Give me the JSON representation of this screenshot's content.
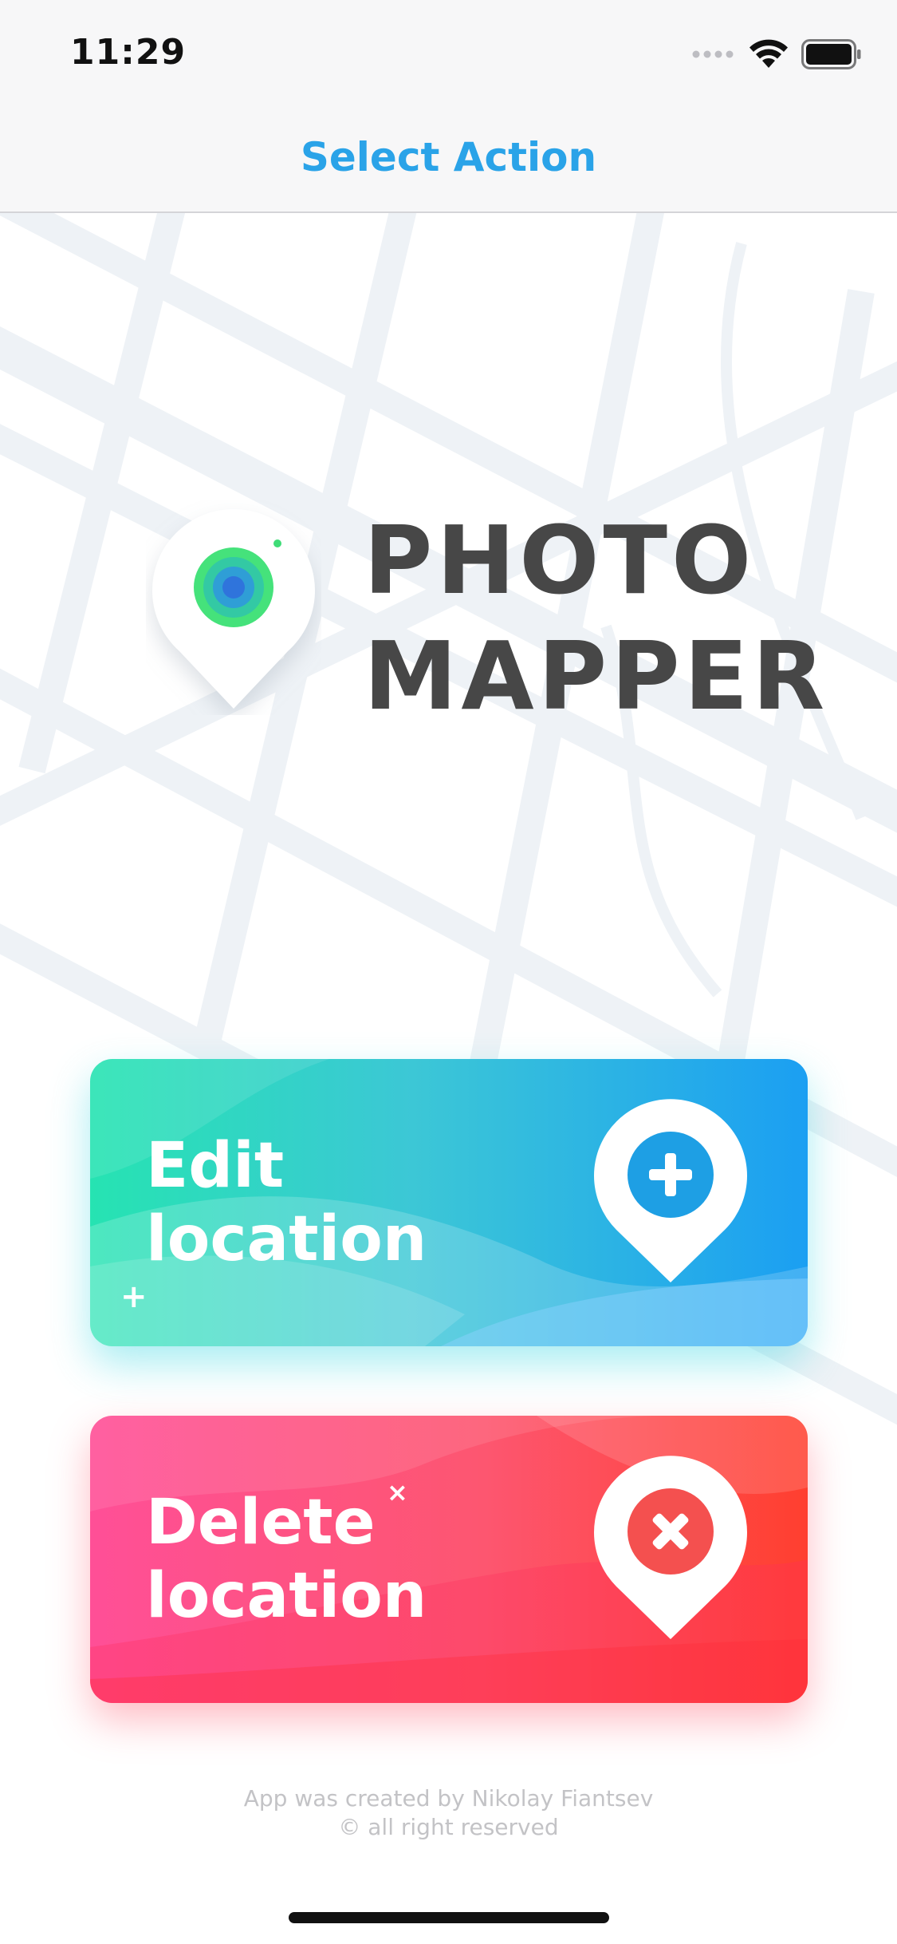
{
  "status_bar": {
    "time": "11:29"
  },
  "nav": {
    "title": "Select Action"
  },
  "logo": {
    "line1": "PHOTO",
    "line2": "MAPPER"
  },
  "actions": [
    {
      "line1": "Edit",
      "line2": "location",
      "icon": "plus-icon",
      "spark": "+"
    },
    {
      "line1": "Delete",
      "line2": "location",
      "icon": "close-icon",
      "spark": "×"
    }
  ],
  "footer": {
    "line1": "App was created by Nikolay Fiantsev",
    "line2": "© all right reserved"
  },
  "colors": {
    "accent": "#2aa3e8",
    "edit_gradient": [
      "#26e3b2",
      "#1b9ff2"
    ],
    "delete_gradient": [
      "#ff4f97",
      "#ff3f2f"
    ],
    "logo_text": "#474747"
  }
}
